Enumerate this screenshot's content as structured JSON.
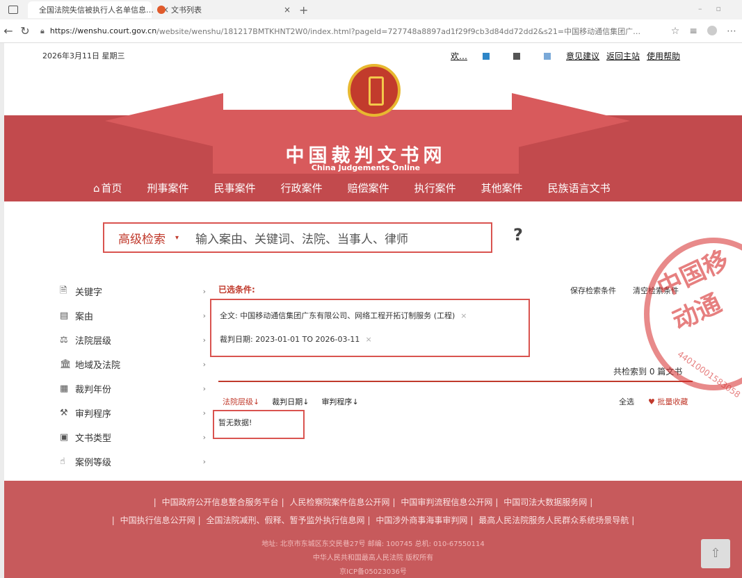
{
  "browser": {
    "tab1_title": "全国法院失信被执行人名单信息…",
    "tab2_title": "文书列表",
    "url_host": "https://wenshu.court.gov.cn",
    "url_rest": "/website/wenshu/181217BMTKHNT2W0/index.html?pageId=727748a8897ad1f29f9cb3d84dd72dd2&s21=中国移动通信集团广…"
  },
  "header": {
    "date": "2026年3月11日 星期三",
    "welcome": "欢…",
    "links": [
      "意见建议",
      "返回主站",
      "使用帮助"
    ],
    "site_title": "中国裁判文书网",
    "site_subtitle": "China Judgements Online"
  },
  "nav": [
    "首页",
    "刑事案件",
    "民事案件",
    "行政案件",
    "赔偿案件",
    "执行案件",
    "其他案件",
    "民族语言文书"
  ],
  "search": {
    "advanced_label": "高级检索",
    "placeholder": "输入案由、关键词、法院、当事人、律师",
    "help": "?"
  },
  "sidebar": [
    {
      "icon": "doc-icon",
      "label": "关键字"
    },
    {
      "icon": "list-icon",
      "label": "案由"
    },
    {
      "icon": "scale-icon",
      "label": "法院层级"
    },
    {
      "icon": "building-icon",
      "label": "地域及法院"
    },
    {
      "icon": "calendar-icon",
      "label": "裁判年份"
    },
    {
      "icon": "gavel-icon",
      "label": "审判程序"
    },
    {
      "icon": "doctype-icon",
      "label": "文书类型"
    },
    {
      "icon": "thumb-icon",
      "label": "案例等级"
    }
  ],
  "conditions": {
    "title": "已选条件:",
    "save": "保存检索条件",
    "clear": "清空检索条件",
    "items": [
      "全文: 中国移动通信集团广东有限公司、网络工程开拓订制服务 (工程)",
      "裁判日期: 2023-01-01 TO 2026-03-11"
    ]
  },
  "results": {
    "total": "共检索到 0 篇文书",
    "sorts": [
      "法院层级",
      "裁判日期",
      "审判程序"
    ],
    "select_all": "全选",
    "batch_fav": "批量收藏",
    "nodata": "暂无数据!"
  },
  "footer": {
    "row1": [
      "中国政府公开信息整合服务平台",
      "人民检察院案件信息公开网",
      "中国审判流程信息公开网",
      "中国司法大数据服务网"
    ],
    "row2": [
      "中国执行信息公开网",
      "全国法院减刑、假释、暂予监外执行信息网",
      "中国涉外商事海事审判网",
      "最高人民法院服务人民群众系统场景导航"
    ],
    "address": "地址: 北京市东城区东交民巷27号   邮编: 100745   总机: 010-67550114",
    "copyright": "中华人民共和国最高人民法院 版权所有",
    "icp": "京ICP备05023036号"
  },
  "colors": {
    "brand_red": "#c24a4d",
    "accent": "#c0392b"
  }
}
